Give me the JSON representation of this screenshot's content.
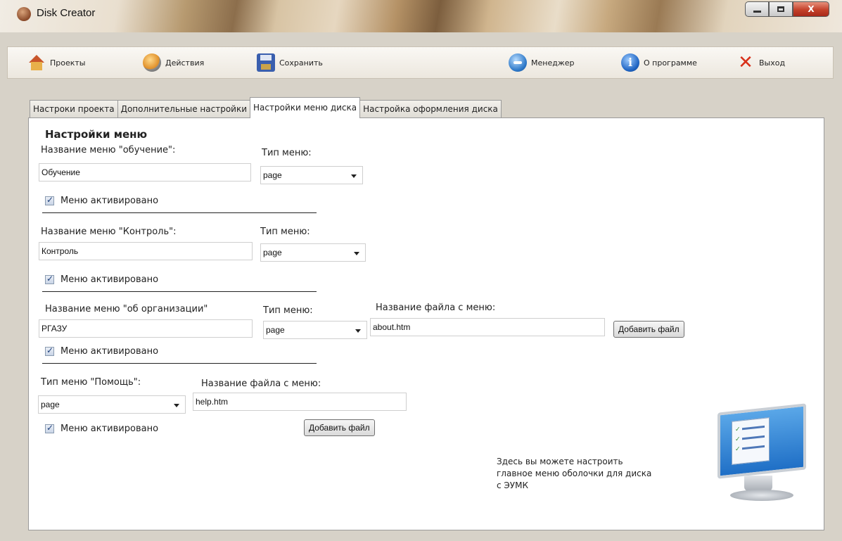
{
  "window": {
    "title": "Disk Creator",
    "close_glyph": "X"
  },
  "toolbar": {
    "projects": "Проекты",
    "actions": "Действия",
    "save": "Сохранить",
    "manager": "Менеджер",
    "about": "О программе",
    "exit": "Выход"
  },
  "tabs": [
    {
      "label": "Настроки проекта",
      "active": false
    },
    {
      "label": "Дополнительные настройки",
      "active": false
    },
    {
      "label": "Настройки меню диска",
      "active": true
    },
    {
      "label": "Настройка оформления диска",
      "active": false
    }
  ],
  "menu_settings": {
    "title": "Настройки меню",
    "menu_type_label": "Тип меню:",
    "file_name_label": "Название файла с меню:",
    "add_file_label": "Добавить файл",
    "enabled_label": "Меню активировано",
    "training": {
      "name_label": "Название меню \"обучение\":",
      "name_value": "Обучение",
      "type_value": "page",
      "enabled": true
    },
    "control": {
      "name_label": "Название меню \"Контроль\":",
      "name_value": "Контроль",
      "type_value": "page",
      "enabled": true
    },
    "organization": {
      "name_label": "Название меню \"об организации\"",
      "name_value": "РГАЗУ",
      "type_value": "page",
      "file_value": "about.htm",
      "enabled": true
    },
    "help": {
      "type_label": "Тип меню \"Помощь\":",
      "type_value": "page",
      "file_value": "help.htm",
      "enabled": true
    },
    "hint": [
      "Здесь вы можете настроить",
      "главное меню оболочки для диска",
      "с ЭУМК"
    ]
  },
  "colors": {
    "panel_bg": "#ffffff",
    "close_button": "#c4412a",
    "checkbox_mark": "#1d3f7a"
  }
}
